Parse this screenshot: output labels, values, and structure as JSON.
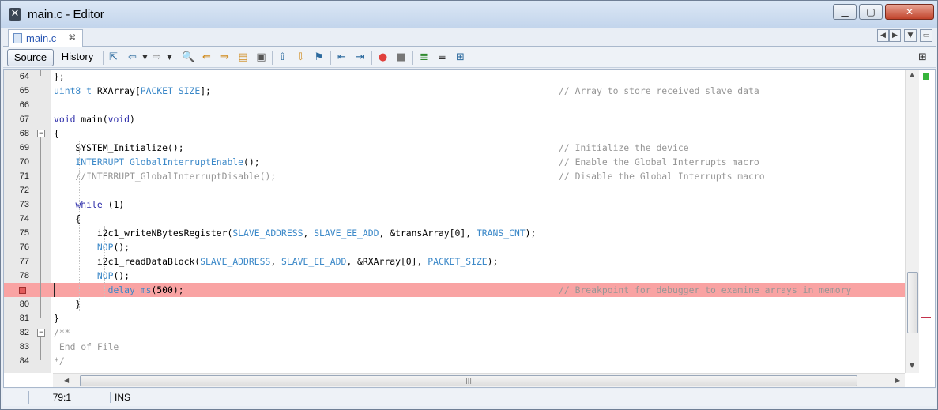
{
  "window": {
    "title": "main.c - Editor"
  },
  "tab": {
    "label": "main.c",
    "close_glyph": "⌘"
  },
  "toolbar": {
    "source_label": "Source",
    "history_label": "History"
  },
  "lines": [
    {
      "n": "64",
      "parts": [
        [
          "t",
          "};"
        ]
      ]
    },
    {
      "n": "65",
      "parts": [
        [
          "m",
          "uint8_t"
        ],
        [
          "t",
          " RXArray["
        ],
        [
          "m",
          "PACKET_SIZE"
        ],
        [
          "t",
          "];"
        ]
      ],
      "comment": "// Array to store received slave data"
    },
    {
      "n": "66",
      "parts": []
    },
    {
      "n": "67",
      "parts": [
        [
          "k",
          "void"
        ],
        [
          "t",
          " main"
        ],
        [
          "t",
          "("
        ],
        [
          "k",
          "void"
        ],
        [
          "t",
          ")"
        ]
      ]
    },
    {
      "n": "68",
      "parts": [
        [
          "t",
          "{"
        ]
      ]
    },
    {
      "n": "69",
      "parts": [
        [
          "t",
          "    SYSTEM_Initialize();"
        ]
      ],
      "comment": "// Initialize the device"
    },
    {
      "n": "70",
      "parts": [
        [
          "t",
          "    "
        ],
        [
          "m",
          "INTERRUPT_GlobalInterruptEnable"
        ],
        [
          "t",
          "();"
        ]
      ],
      "comment": "// Enable the Global Interrupts macro"
    },
    {
      "n": "71",
      "parts": [
        [
          "c",
          "    //INTERRUPT_GlobalInterruptDisable();"
        ]
      ],
      "comment": "// Disable the Global Interrupts macro"
    },
    {
      "n": "72",
      "parts": []
    },
    {
      "n": "73",
      "parts": [
        [
          "t",
          "    "
        ],
        [
          "k",
          "while"
        ],
        [
          "t",
          " (1)"
        ]
      ]
    },
    {
      "n": "74",
      "parts": [
        [
          "t",
          "    {"
        ]
      ]
    },
    {
      "n": "75",
      "parts": [
        [
          "t",
          "        i2c1_writeNBytesRegister("
        ],
        [
          "m",
          "SLAVE_ADDRESS"
        ],
        [
          "t",
          ", "
        ],
        [
          "m",
          "SLAVE_EE_ADD"
        ],
        [
          "t",
          ", &transArray[0], "
        ],
        [
          "m",
          "TRANS_CNT"
        ],
        [
          "t",
          ");"
        ]
      ]
    },
    {
      "n": "76",
      "parts": [
        [
          "t",
          "        "
        ],
        [
          "m",
          "NOP"
        ],
        [
          "t",
          "();"
        ]
      ]
    },
    {
      "n": "77",
      "parts": [
        [
          "t",
          "        i2c1_readDataBlock("
        ],
        [
          "m",
          "SLAVE_ADDRESS"
        ],
        [
          "t",
          ", "
        ],
        [
          "m",
          "SLAVE_EE_ADD"
        ],
        [
          "t",
          ", &RXArray[0], "
        ],
        [
          "m",
          "PACKET_SIZE"
        ],
        [
          "t",
          ");"
        ]
      ]
    },
    {
      "n": "78",
      "parts": [
        [
          "t",
          "        "
        ],
        [
          "m",
          "NOP"
        ],
        [
          "t",
          "();"
        ]
      ]
    },
    {
      "n": "",
      "breakpoint": true,
      "parts": [
        [
          "t",
          "        "
        ],
        [
          "m",
          "__delay_ms"
        ],
        [
          "t",
          "(500);"
        ]
      ],
      "comment": "// Breakpoint for debugger to examine arrays in memory"
    },
    {
      "n": "80",
      "parts": [
        [
          "t",
          "    }"
        ]
      ]
    },
    {
      "n": "81",
      "parts": [
        [
          "t",
          "}"
        ]
      ]
    },
    {
      "n": "82",
      "parts": [
        [
          "c",
          "/**"
        ]
      ]
    },
    {
      "n": "83",
      "parts": [
        [
          "c",
          " End of File"
        ]
      ]
    },
    {
      "n": "84",
      "parts": [
        [
          "c",
          "*/"
        ]
      ]
    }
  ],
  "status": {
    "position": "79:1",
    "mode": "INS"
  },
  "colors": {
    "breakpoint_bg": "#f9a3a3",
    "keyword": "#2a2aa8",
    "macro": "#3b88c8",
    "comment": "#969696"
  }
}
